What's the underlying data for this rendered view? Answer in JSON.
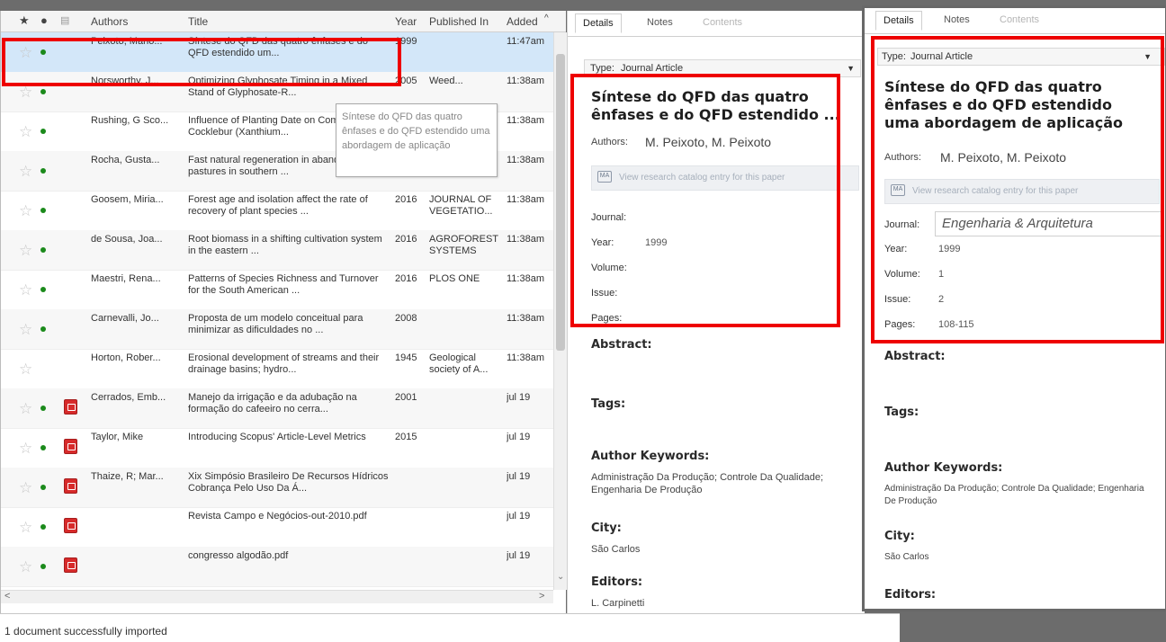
{
  "list": {
    "columns": {
      "authors": "Authors",
      "title": "Title",
      "year": "Year",
      "published_in": "Published In",
      "added": "Added"
    },
    "rows": [
      {
        "authors": "Peixoto, Mano...",
        "title": "Síntese do QFD das quatro ênfases e do QFD estendido um...",
        "year": "1999",
        "published_in": "",
        "added": "11:47am",
        "starred": false,
        "unread": true,
        "pdf": false,
        "selected": true
      },
      {
        "authors": "Norsworthy, J...",
        "title": "Optimizing Glyphosate Timing in a Mixed Stand of Glyphosate-R...",
        "year": "2005",
        "published_in": "Weed...",
        "added": "11:38am",
        "starred": false,
        "unread": true,
        "pdf": false,
        "selected": false
      },
      {
        "authors": "Rushing, G Sco...",
        "title": "Influence of Planting Date on Common Cocklebur (Xanthium...",
        "year": "",
        "published_in": "",
        "added": "11:38am",
        "starred": false,
        "unread": true,
        "pdf": false,
        "selected": false
      },
      {
        "authors": "Rocha, Gusta...",
        "title": "Fast natural regeneration in abandoned pastures in southern ...",
        "year": "2016",
        "published_in": "FOREST ECOLOGY A...",
        "added": "11:38am",
        "starred": false,
        "unread": true,
        "pdf": false,
        "selected": false
      },
      {
        "authors": "Goosem, Miria...",
        "title": "Forest age and isolation affect the rate of recovery of plant species ...",
        "year": "2016",
        "published_in": "JOURNAL OF VEGETATIO...",
        "added": "11:38am",
        "starred": false,
        "unread": true,
        "pdf": false,
        "selected": false
      },
      {
        "authors": "de Sousa, Joa...",
        "title": "Root biomass in a shifting cultivation system in the eastern ...",
        "year": "2016",
        "published_in": "AGROFOREST SYSTEMS",
        "added": "11:38am",
        "starred": false,
        "unread": true,
        "pdf": false,
        "selected": false
      },
      {
        "authors": "Maestri, Rena...",
        "title": "Patterns of Species Richness and Turnover for the South American ...",
        "year": "2016",
        "published_in": "PLOS ONE",
        "added": "11:38am",
        "starred": false,
        "unread": true,
        "pdf": false,
        "selected": false
      },
      {
        "authors": "Carnevalli, Jo...",
        "title": "Proposta de um modelo conceitual para minimizar as dificuldades no ...",
        "year": "2008",
        "published_in": "",
        "added": "11:38am",
        "starred": false,
        "unread": true,
        "pdf": false,
        "selected": false
      },
      {
        "authors": "Horton, Rober...",
        "title": "Erosional development of streams and their drainage basins; hydro...",
        "year": "1945",
        "published_in": "Geological society of A...",
        "added": "11:38am",
        "starred": false,
        "unread": false,
        "pdf": false,
        "selected": false
      },
      {
        "authors": "Cerrados, Emb...",
        "title": "Manejo da irrigação e da adubação na formação do cafeeiro no cerra...",
        "year": "2001",
        "published_in": "",
        "added": "jul 19",
        "starred": false,
        "unread": true,
        "pdf": true,
        "selected": false
      },
      {
        "authors": "Taylor, Mike",
        "title": "Introducing Scopus' Article-Level Metrics",
        "year": "2015",
        "published_in": "",
        "added": "jul 19",
        "starred": false,
        "unread": true,
        "pdf": true,
        "selected": false
      },
      {
        "authors": "Thaize, R; Mar...",
        "title": "Xix Simpósio Brasileiro De Recursos Hídricos Cobrança Pelo Uso Da Á...",
        "year": "",
        "published_in": "",
        "added": "jul 19",
        "starred": false,
        "unread": true,
        "pdf": true,
        "selected": false
      },
      {
        "authors": "",
        "title": "Revista Campo e Negócios-out-2010.pdf",
        "year": "",
        "published_in": "",
        "added": "jul 19",
        "starred": false,
        "unread": true,
        "pdf": true,
        "selected": false
      },
      {
        "authors": "",
        "title": "congresso algodão.pdf",
        "year": "",
        "published_in": "",
        "added": "jul 19",
        "starred": false,
        "unread": true,
        "pdf": true,
        "selected": false
      }
    ],
    "tooltip": "Síntese do QFD das quatro ênfases e do QFD estendido uma abordagem de aplicação",
    "scroll_left": "<",
    "scroll_right": ">"
  },
  "status": {
    "message": "1 document successfully imported"
  },
  "details": {
    "tabs": [
      "Details",
      "Notes",
      "Contents"
    ],
    "type_label": "Type:",
    "type_value": "Journal Article",
    "title_short": "Síntese do QFD das quatro ênfases e do QFD estendido ...",
    "authors_label": "Authors:",
    "authors_value": "M. Peixoto, M. Peixoto",
    "catalog_button": "View research catalog entry for this paper",
    "fields": [
      {
        "label": "Journal:",
        "value": ""
      },
      {
        "label": "Year:",
        "value": "1999"
      },
      {
        "label": "Volume:",
        "value": ""
      },
      {
        "label": "Issue:",
        "value": ""
      },
      {
        "label": "Pages:",
        "value": ""
      }
    ],
    "abstract_label": "Abstract:",
    "tags_label": "Tags:",
    "keywords_label": "Author Keywords:",
    "keywords_value": "Administração Da Produção; Controle Da Qualidade; Engenharia De Produção",
    "city_label": "City:",
    "city_value": "São Carlos",
    "editors_label": "Editors:",
    "editors_value": "L. Carpinetti"
  },
  "zoom": {
    "tabs": [
      "Details",
      "Notes",
      "Contents"
    ],
    "type_label": "Type:",
    "type_value": "Journal Article",
    "title_full": "Síntese do QFD das quatro ênfases e do QFD estendido uma abordagem de aplicação",
    "authors_label": "Authors:",
    "authors_value": "M. Peixoto, M. Peixoto",
    "catalog_button": "View research catalog entry for this paper",
    "journal_label": "Journal:",
    "journal_value": "Engenharia & Arquitetura",
    "fields": [
      {
        "label": "Year:",
        "value": "1999"
      },
      {
        "label": "Volume:",
        "value": "1"
      },
      {
        "label": "Issue:",
        "value": "2"
      },
      {
        "label": "Pages:",
        "value": "108-115"
      }
    ],
    "abstract_label": "Abstract:",
    "tags_label": "Tags:",
    "keywords_label": "Author Keywords:",
    "keywords_value": "Administração Da Produção; Controle Da Qualidade; Engenharia De Produção",
    "city_label": "City:",
    "city_value": "São Carlos",
    "editors_label": "Editors:"
  },
  "colors": {
    "highlight": "#ee0000",
    "selected_row": "#d3e7f9",
    "unread_dot": "#1b8a1b",
    "pdf_icon": "#d72a2a"
  },
  "icons": {
    "star": "star-icon",
    "unread": "unread-dot-icon",
    "pdf": "pdf-icon",
    "sort_arrow": "sort-arrow-icon",
    "dropdown": "chevron-down-icon",
    "catalog": "book-icon"
  }
}
